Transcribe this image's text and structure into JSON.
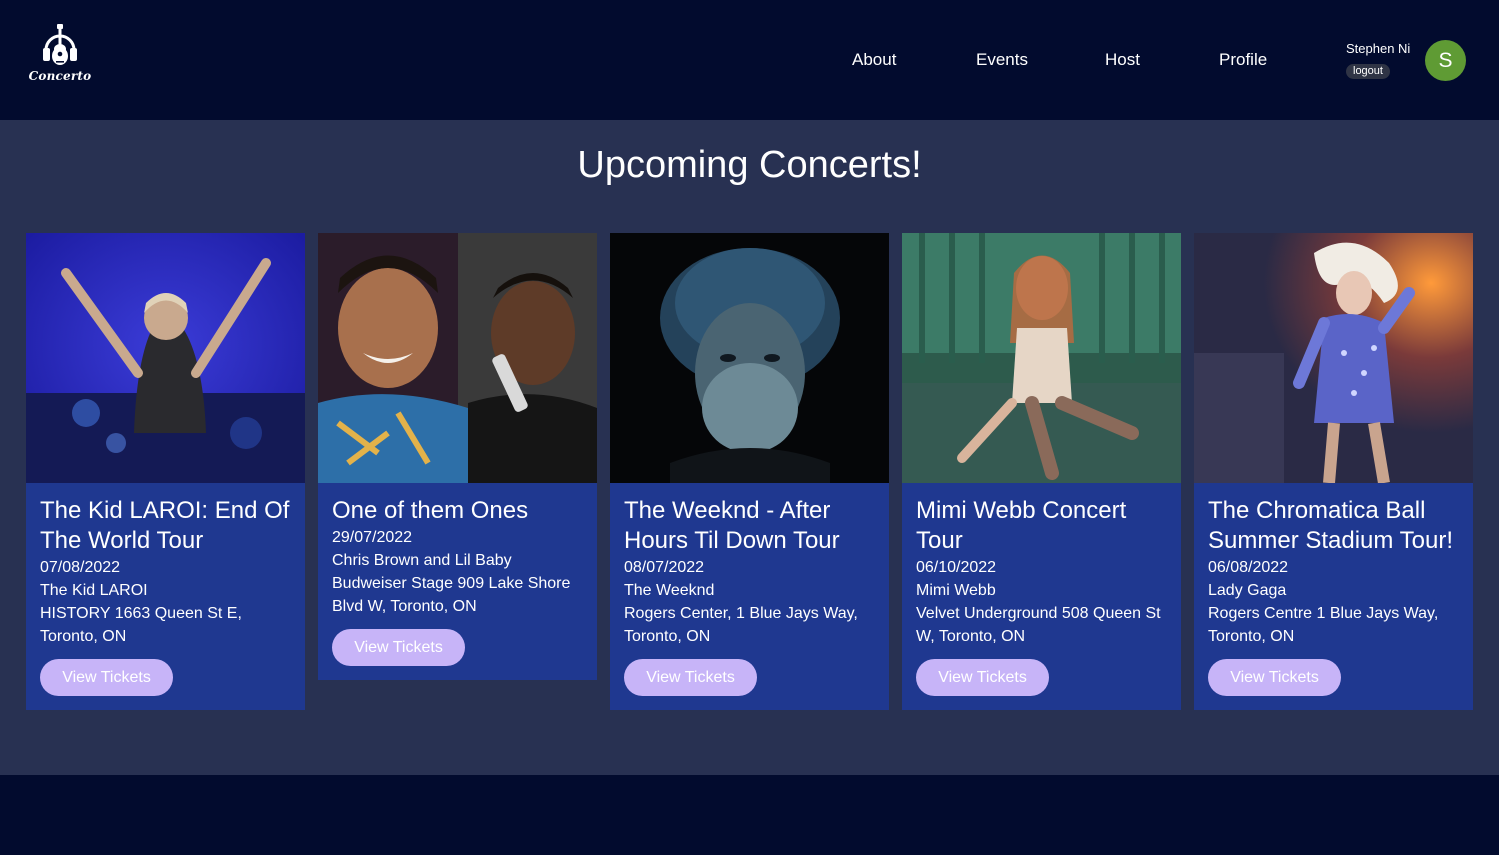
{
  "header": {
    "logo_text": "Concerto",
    "nav": [
      "About",
      "Events",
      "Host",
      "Profile"
    ],
    "user_name": "Stephen Ni",
    "logout_label": "logout",
    "avatar_initial": "S"
  },
  "main": {
    "title": "Upcoming Concerts!",
    "cards": [
      {
        "title": "The Kid LAROI: End Of The World Tour",
        "date": "07/08/2022",
        "artist": "The Kid LAROI",
        "venue": "HISTORY 1663 Queen St E, Toronto, ON",
        "button": "View Tickets"
      },
      {
        "title": "One of them Ones",
        "date": "29/07/2022",
        "artist": "Chris Brown and Lil Baby",
        "venue": "Budweiser Stage 909 Lake Shore Blvd W, Toronto, ON",
        "button": "View Tickets"
      },
      {
        "title": "The Weeknd - After Hours Til Down Tour",
        "date": "08/07/2022",
        "artist": "The Weeknd",
        "venue": "Rogers Center, 1 Blue Jays Way, Toronto, ON",
        "button": "View Tickets"
      },
      {
        "title": "Mimi Webb Concert Tour",
        "date": "06/10/2022",
        "artist": "Mimi Webb",
        "venue": "Velvet Underground 508 Queen St W, Toronto, ON",
        "button": "View Tickets"
      },
      {
        "title": "The Chromatica Ball Summer Stadium Tour!",
        "date": "06/08/2022",
        "artist": "Lady Gaga",
        "venue": "Rogers Centre 1 Blue Jays Way, Toronto, ON",
        "button": "View Tickets"
      }
    ]
  },
  "colors": {
    "nav_bg": "#020b2e",
    "main_bg": "#283152",
    "card_bg": "#1f3890",
    "button_bg": "#c7b4f8",
    "avatar_bg": "#5f9b34"
  }
}
